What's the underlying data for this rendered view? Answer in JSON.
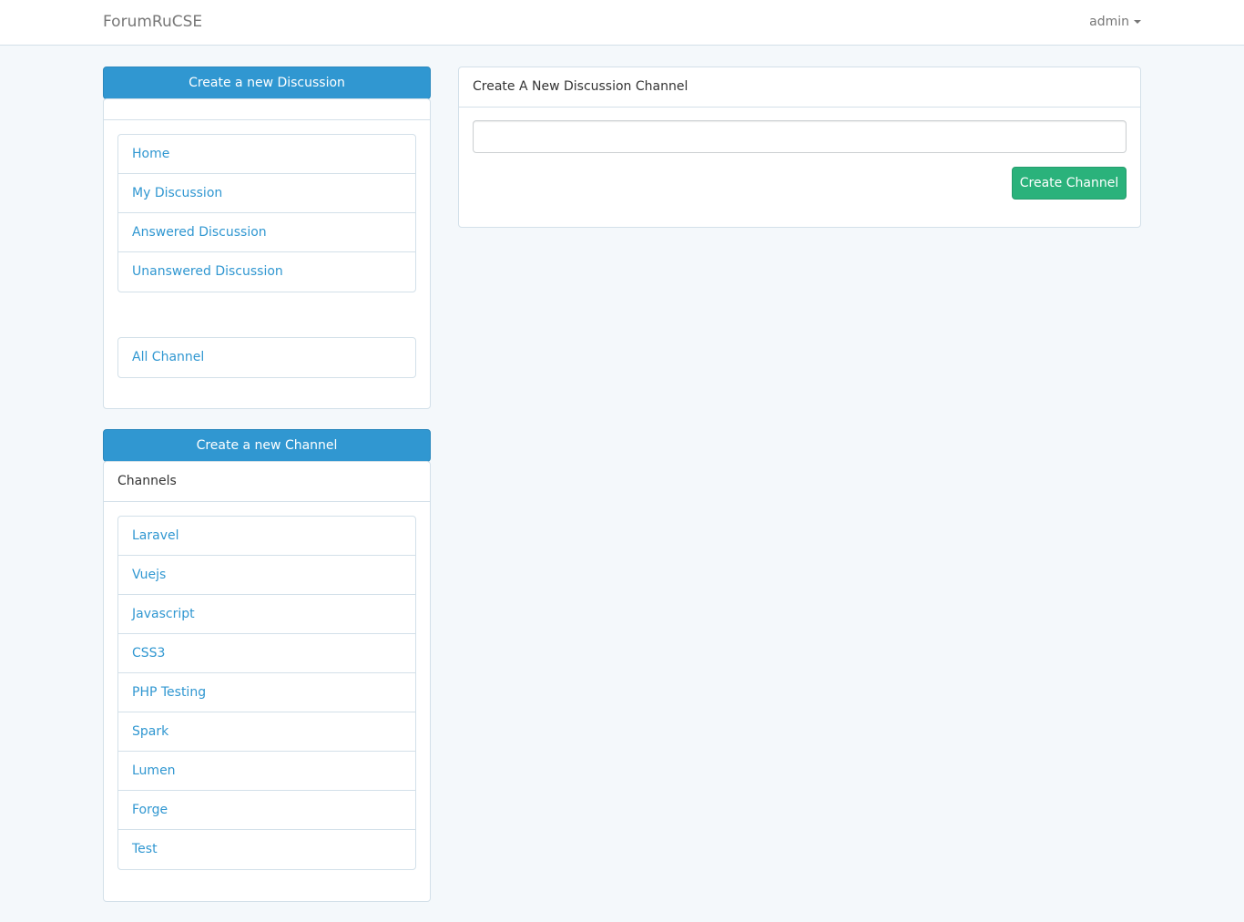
{
  "navbar": {
    "brand": "ForumRuCSE",
    "user": "admin",
    "user_icon": "caret-down-icon"
  },
  "sidebar": {
    "create_discussion_label": "Create a new Discussion",
    "nav_items": [
      {
        "label": "Home"
      },
      {
        "label": "My Discussion"
      },
      {
        "label": "Answered Discussion"
      },
      {
        "label": "Unanswered Discussion"
      }
    ],
    "all_channel_label": "All Channel",
    "create_channel_label": "Create a new Channel",
    "channels_heading": "Channels",
    "channels": [
      {
        "label": "Laravel"
      },
      {
        "label": "Vuejs"
      },
      {
        "label": "Javascript"
      },
      {
        "label": "CSS3"
      },
      {
        "label": "PHP Testing"
      },
      {
        "label": "Spark"
      },
      {
        "label": "Lumen"
      },
      {
        "label": "Forge"
      },
      {
        "label": "Test"
      }
    ]
  },
  "main": {
    "panel_heading": "Create A New Discussion Channel",
    "channel_input_value": "",
    "submit_label": "Create Channel"
  },
  "colors": {
    "primary": "#3097d1",
    "success": "#2ab27b",
    "background": "#f4f8fb"
  }
}
